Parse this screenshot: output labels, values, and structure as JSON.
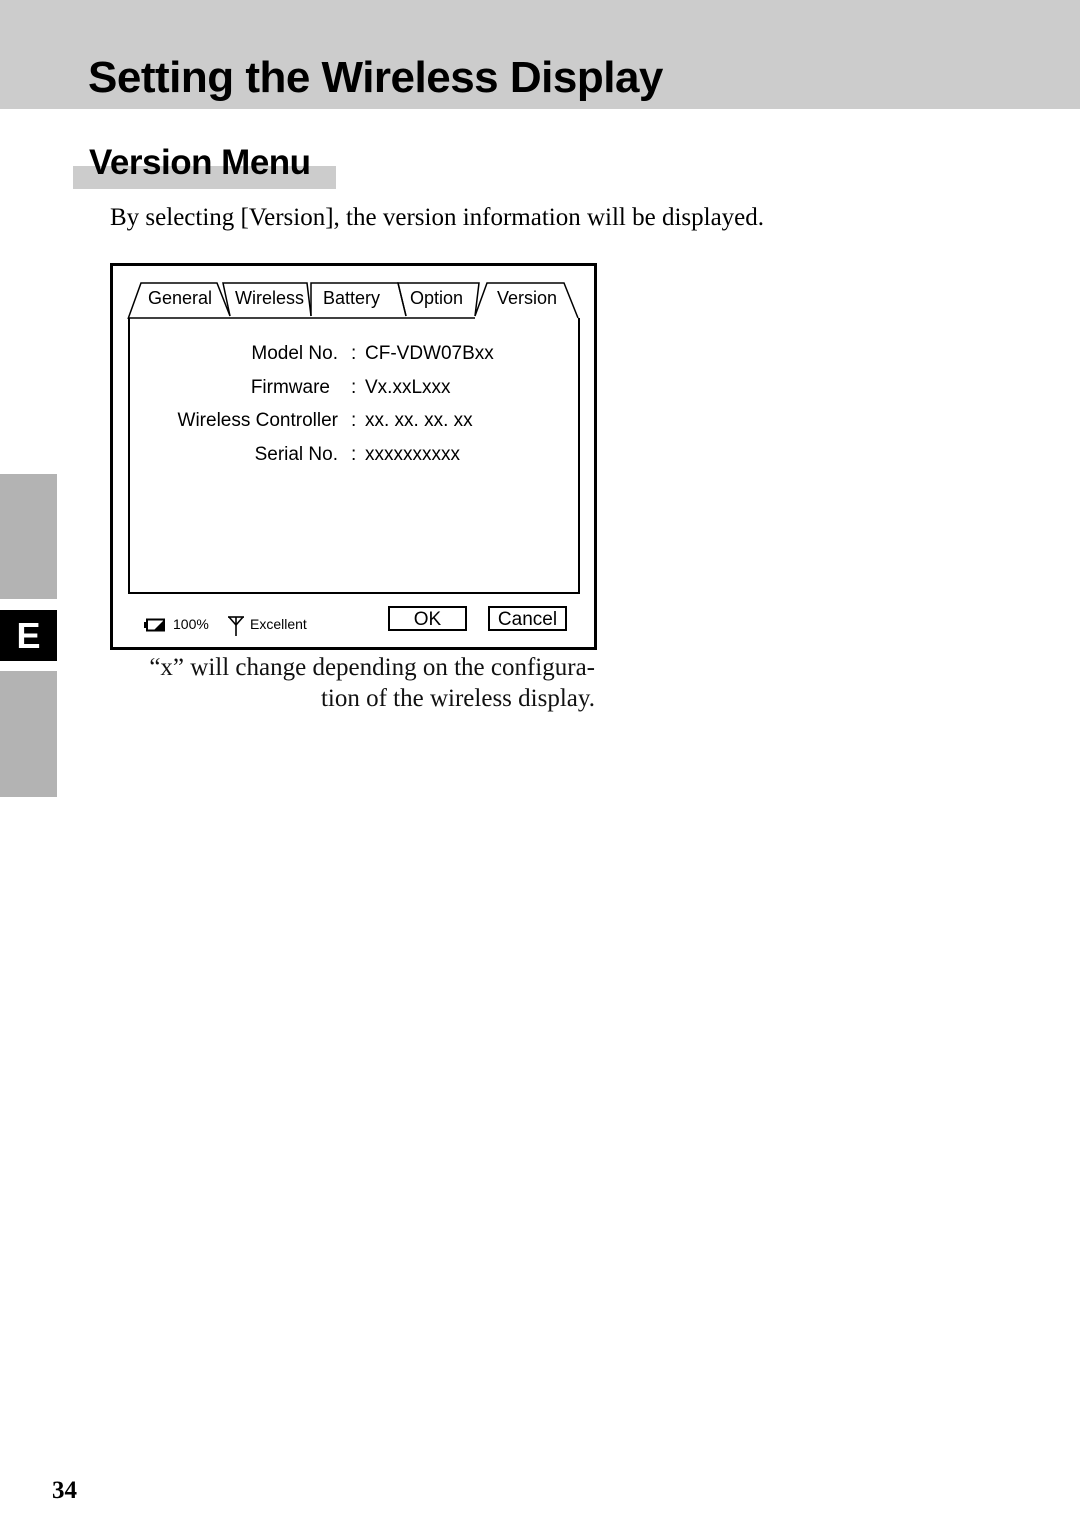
{
  "header": {
    "title": "Setting the Wireless Display"
  },
  "section": {
    "title": "Version Menu",
    "intro": "By selecting [Version], the version information will be displayed."
  },
  "dialog": {
    "tabs": [
      {
        "label": "General",
        "active": false
      },
      {
        "label": "Wireless",
        "active": false
      },
      {
        "label": "Battery",
        "active": false
      },
      {
        "label": "Option",
        "active": false
      },
      {
        "label": "Version",
        "active": true
      }
    ],
    "info": [
      {
        "label": "Model No.",
        "separator": ":",
        "value": "CF-VDW07Bxx"
      },
      {
        "label": "Firmware",
        "separator": ":",
        "value": "Vx.xxLxxx"
      },
      {
        "label": "Wireless Controller",
        "separator": ":",
        "value": "xx. xx. xx. xx"
      },
      {
        "label": "Serial No.",
        "separator": ":",
        "value": "xxxxxxxxxx"
      }
    ],
    "status": {
      "battery_icon": "battery-icon",
      "battery_level": "100%",
      "signal_icon": "antenna-icon",
      "signal_quality": "Excellent"
    },
    "buttons": {
      "ok": "OK",
      "cancel": "Cancel"
    }
  },
  "note": "“x” will change depending on the configura- tion of the wireless display.",
  "side_tab": {
    "label": "E"
  },
  "footer": {
    "page_number": "34"
  }
}
